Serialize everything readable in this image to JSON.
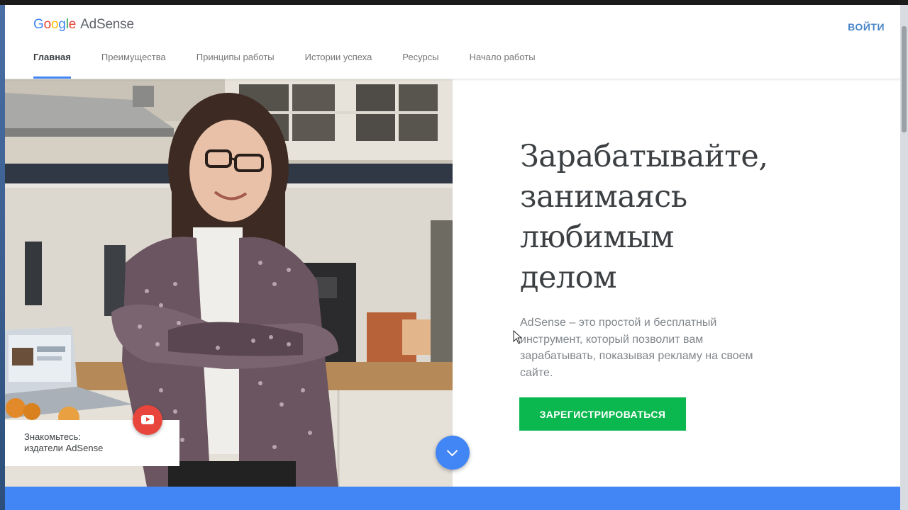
{
  "header": {
    "logo": {
      "google": [
        "G",
        "o",
        "o",
        "g",
        "l",
        "e"
      ],
      "product": "AdSense"
    },
    "signin_label": "ВОЙТИ",
    "nav": [
      {
        "label": "Главная",
        "active": true
      },
      {
        "label": "Преимущества",
        "active": false
      },
      {
        "label": "Принципы работы",
        "active": false
      },
      {
        "label": "Истории успеха",
        "active": false
      },
      {
        "label": "Ресурсы",
        "active": false
      },
      {
        "label": "Начало работы",
        "active": false
      }
    ]
  },
  "hero": {
    "headline_lines": [
      "Зарабатывайте,",
      "занимаясь",
      "любимым",
      "делом"
    ],
    "description_lines": [
      "AdSense – это простой и бесплатный",
      "инструмент, который позволит вам",
      "зарабатывать, показывая рекламу на своем",
      "сайте."
    ],
    "cta_label": "ЗАРЕГИСТРИРОВАТЬСЯ",
    "promo_lines": [
      "Знакомьтесь:",
      "издатели AdSense"
    ]
  },
  "colors": {
    "accent_blue": "#4285f4",
    "cta_green": "#0bb850",
    "play_red": "#e8453c",
    "signin_blue": "#4a86c8"
  },
  "icons": {
    "play": "youtube-play-icon",
    "scroll": "chevron-down-icon",
    "cursor": "mouse-cursor-icon"
  }
}
